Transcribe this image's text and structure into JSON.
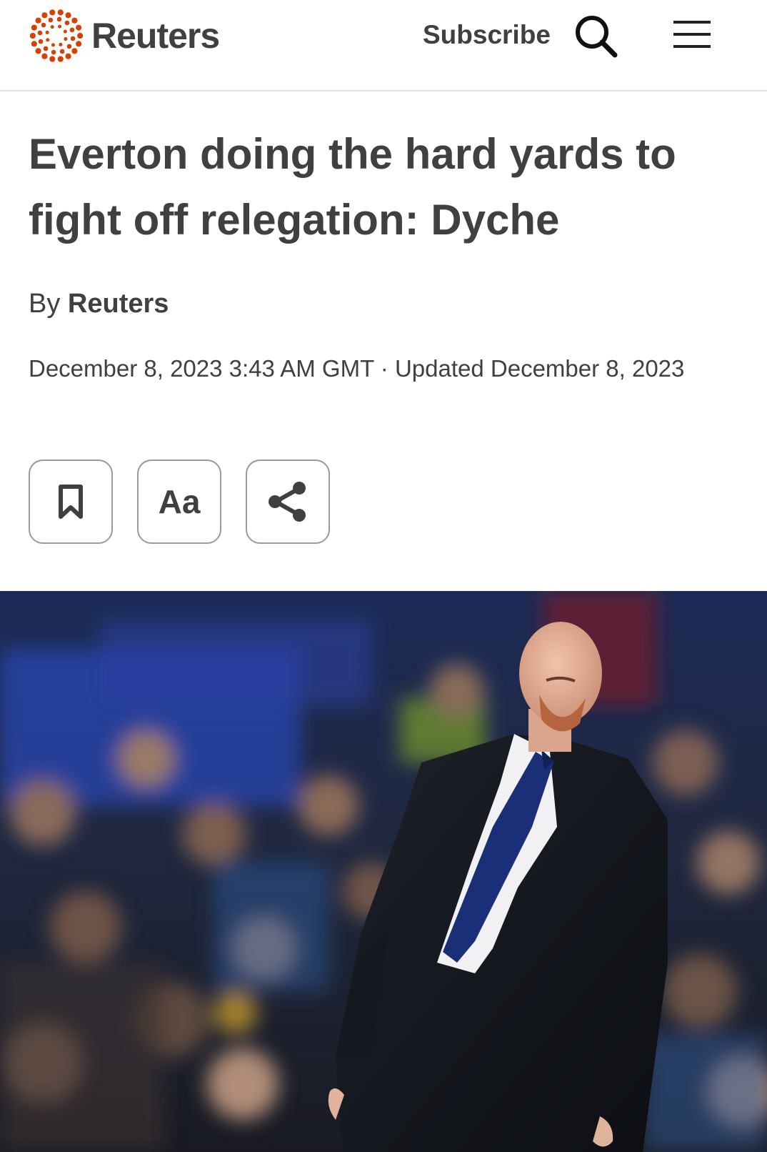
{
  "header": {
    "brand_name": "Reuters",
    "subscribe_label": "Subscribe",
    "icons": [
      "reuters-logo-icon",
      "search-icon",
      "hamburger-menu-icon"
    ]
  },
  "article": {
    "headline": "Everton doing the hard yards to fight off relegation: Dyche",
    "byline_prefix": "By",
    "byline_author": "Reuters",
    "dateline": "December 8, 2023 3:43 AM GMT · Updated December 8, 2023"
  },
  "toolbar": {
    "text_size_label": "Aa",
    "icons": [
      "bookmark-icon",
      "text-size-icon",
      "share-icon"
    ]
  },
  "colors": {
    "brand_orange": "#d64000",
    "text": "#404040",
    "button_border": "#9a9a9a"
  }
}
